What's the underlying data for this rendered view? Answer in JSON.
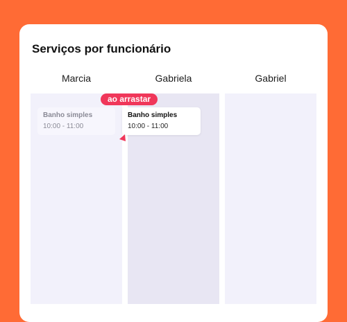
{
  "title": "Serviços por funcionário",
  "columns": [
    {
      "name": "Marcia"
    },
    {
      "name": "Gabriela"
    },
    {
      "name": "Gabriel"
    }
  ],
  "drag_badge": "ao arrastar",
  "events": {
    "ghost": {
      "name": "Banho simples",
      "time": "10:00 - 11:00"
    },
    "dragging": {
      "name": "Banho simples",
      "time": "10:00 - 11:00"
    }
  },
  "colors": {
    "background": "#ff6b35",
    "badge": "#f0375a",
    "column": "#f2f1fb",
    "column_highlight": "#e8e6f3"
  }
}
